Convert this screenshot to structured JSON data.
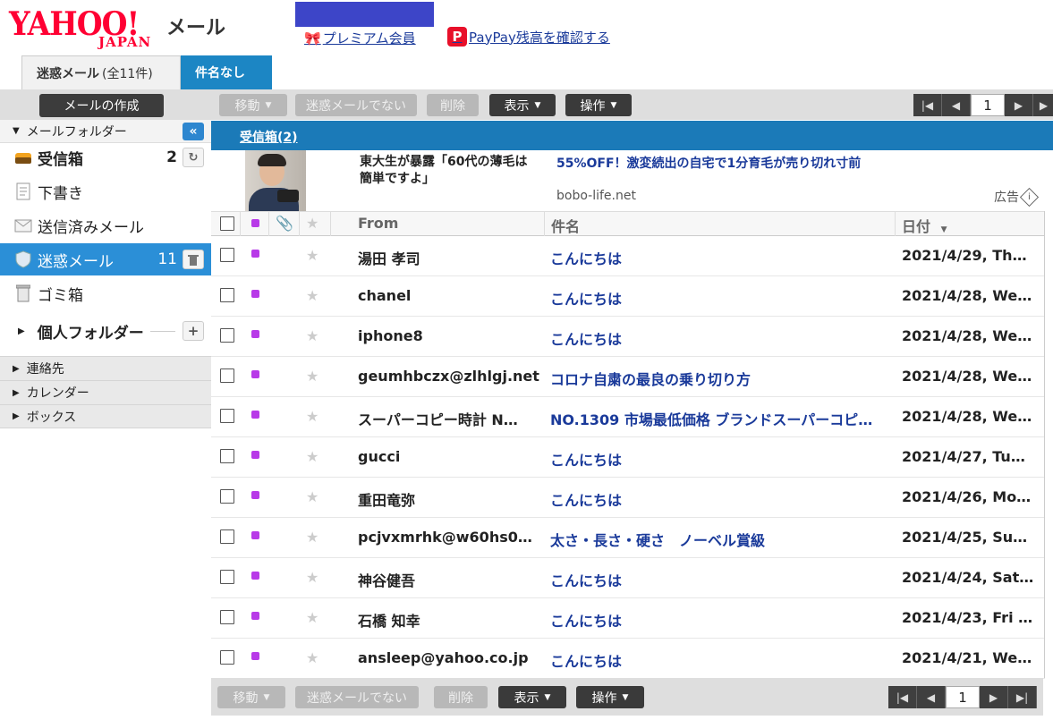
{
  "header": {
    "logo_main": "YAHOO!",
    "logo_sub": "JAPAN",
    "service_name": "メール",
    "premium_link": "プレミアム会員",
    "paypay_icon": "P",
    "paypay_link": "PayPay残高を確認する",
    "ad_block_color": "#3d45c8"
  },
  "tabs": [
    {
      "label": "迷惑メール",
      "count": "(全11件)",
      "active": true
    },
    {
      "label": "件名なし",
      "active": false
    }
  ],
  "sidebar": {
    "compose_label": "メールの作成",
    "folder_header": "メールフォルダー",
    "collapse_icon": "«",
    "folders": [
      {
        "name": "受信箱",
        "count": "2",
        "icon": "inbox-icon",
        "bold": true,
        "action": "refresh-icon"
      },
      {
        "name": "下書き",
        "count": "",
        "icon": "draft-icon"
      },
      {
        "name": "送信済みメール",
        "count": "",
        "icon": "sent-icon"
      },
      {
        "name": "迷惑メール",
        "count": "11",
        "icon": "spam-shield-icon",
        "selected": true,
        "action": "trash-icon"
      },
      {
        "name": "ゴミ箱",
        "count": "",
        "icon": "trash-can-icon"
      }
    ],
    "personal_folder": "個人フォルダー",
    "sections": [
      "連絡先",
      "カレンダー",
      "ボックス"
    ]
  },
  "toolbar": {
    "move": "移動",
    "not_spam": "迷惑メールでない",
    "delete": "削除",
    "view": "表示",
    "operation": "操作",
    "page": "1"
  },
  "inbox_bar": {
    "label": "受信箱(2)"
  },
  "ad": {
    "title": "東大生が暴露「60代の薄毛は簡単ですよ」",
    "headline": "55%OFF！激変続出の自宅で1分育毛が売り切れ寸前",
    "domain": "bobo-life.net",
    "label": "広告"
  },
  "list": {
    "col_from": "From",
    "col_subject": "件名",
    "col_date": "日付",
    "rows": [
      {
        "from": "湯田 孝司",
        "subject": "こんにちは",
        "date": "2021/4/29, Th…"
      },
      {
        "from": "chanel",
        "subject": "こんにちは",
        "date": "2021/4/28, We…"
      },
      {
        "from": "iphone8",
        "subject": "こんにちは",
        "date": "2021/4/28, We…"
      },
      {
        "from": "geumhbczx@zlhlgj.net",
        "subject": "コロナ自粛の最良の乗り切り方",
        "date": "2021/4/28, We…"
      },
      {
        "from": "スーパーコピー時計 N…",
        "subject": "NO.1309 市場最低価格 ブランドスーパーコピ…",
        "date": "2021/4/28, We…"
      },
      {
        "from": "gucci",
        "subject": "こんにちは",
        "date": "2021/4/27, Tu…"
      },
      {
        "from": "重田竜弥",
        "subject": "こんにちは",
        "date": "2021/4/26, Mo…"
      },
      {
        "from": "pcjvxmrhk@w60hs0…",
        "subject": "太さ・長さ・硬さ　ノーベル賞級",
        "date": "2021/4/25, Su…"
      },
      {
        "from": "神谷健吾",
        "subject": "こんにちは",
        "date": "2021/4/24, Sat…"
      },
      {
        "from": "石橋 知幸",
        "subject": "こんにちは",
        "date": "2021/4/23, Fri …"
      },
      {
        "from": "ansleep@yahoo.co.jp",
        "subject": "こんにちは",
        "date": "2021/4/21, We…"
      }
    ]
  }
}
